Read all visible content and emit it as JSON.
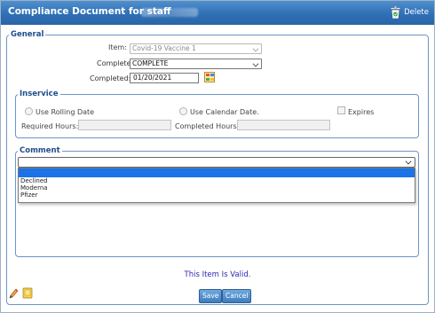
{
  "window": {
    "title": "Compliance Document for staff",
    "delete_label": "Delete"
  },
  "general": {
    "legend": "General",
    "item_label": "Item:",
    "item_value": "Covid-19 Vaccine 1",
    "complete_label": "Complete",
    "complete_value": "COMPLETE",
    "completed_label": "Completed:",
    "completed_value": "01/20/2021"
  },
  "inservice": {
    "legend": "Inservice",
    "rolling_label": "Use Rolling Date",
    "calendar_label": "Use Calendar Date.",
    "expires_label": "Expires",
    "required_hours_label": "Required Hours:",
    "completed_hours_label": "Completed Hours:"
  },
  "comment": {
    "legend": "Comment",
    "selected": "",
    "options": [
      "",
      "Declined",
      "Moderna",
      "Pfizer"
    ]
  },
  "status_text": "This Item Is Valid.",
  "buttons": {
    "save": "Save",
    "cancel": "Cancel"
  },
  "icons": {
    "delete": "trash-icon",
    "calendar": "calendar-icon",
    "edit": "pencil-icon",
    "notes": "note-icon"
  },
  "colors": {
    "titlebar": "#2f6fb5",
    "legend": "#1e4e8c",
    "selected_option": "#1a73e8",
    "valid_text": "#2a2ab0"
  }
}
